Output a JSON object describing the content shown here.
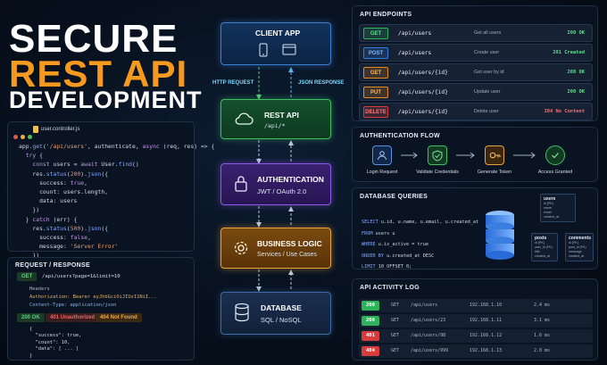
{
  "title": {
    "line1": "SECURE",
    "line2": "REST API",
    "line3": "DEVELOPMENT"
  },
  "editor": {
    "filename": "user.controller.js",
    "lines": [
      "app.get('/api/users', authenticate, async (req, res) => {",
      "  try {",
      "    const users = await User.find()",
      "    res.status(200).json({",
      "      success: true,",
      "      count: users.length,",
      "      data: users",
      "    })",
      "  } catch (err) {",
      "    res.status(500).json({",
      "      success: false,",
      "      message: 'Server Error'",
      "    })",
      "  }",
      "})"
    ]
  },
  "request_response": {
    "title": "REQUEST / RESPONSE",
    "method": "GET",
    "url": "/api/users?page=1&limit=10",
    "headers_label": "Headers",
    "auth_header": "Authorization: Bearer eyJhbGciOiJIUzI1NiI...",
    "content_type": "Content-Type: application/json",
    "status_ok": "200 OK",
    "status_401": "401 Unauthorized",
    "status_404": "404 Not Found",
    "body_lines": [
      "{",
      "  \"success\": true,",
      "  \"count\": 10,",
      "  \"data\": [ ... ]",
      "}"
    ]
  },
  "diagram": {
    "client": {
      "title": "CLIENT APP"
    },
    "http_request": "HTTP REQUEST",
    "json_response": "JSON RESPONSE",
    "rest": {
      "title": "REST API",
      "sub": "/api/*"
    },
    "auth": {
      "title": "AUTHENTICATION",
      "sub": "JWT / OAuth 2.0"
    },
    "logic": {
      "title": "BUSINESS LOGIC",
      "sub": "Services / Use Cases"
    },
    "db": {
      "title": "DATABASE",
      "sub": "SQL / NoSQL"
    }
  },
  "endpoints": {
    "title": "API ENDPOINTS",
    "rows": [
      {
        "method": "GET",
        "path": "/api/users",
        "desc": "Get all users",
        "status": "200 OK",
        "color": "#2fb35a"
      },
      {
        "method": "POST",
        "path": "/api/users",
        "desc": "Create user",
        "status": "201 Created",
        "color": "#2f7ee8"
      },
      {
        "method": "GET",
        "path": "/api/users/{id}",
        "desc": "Get user by id",
        "status": "200 OK",
        "color": "#e8891f"
      },
      {
        "method": "PUT",
        "path": "/api/users/{id}",
        "desc": "Update user",
        "status": "200 OK",
        "color": "#e8891f"
      },
      {
        "method": "DELETE",
        "path": "/api/users/{id}",
        "desc": "Delete user",
        "status": "204 No Content",
        "color": "#d83b3b"
      }
    ]
  },
  "auth_flow": {
    "title": "AUTHENTICATION FLOW",
    "steps": [
      "Login Request",
      "Validate Credentials",
      "Generate Token",
      "Access Granted"
    ]
  },
  "db_queries": {
    "title": "DATABASE QUERIES",
    "sql": [
      "SELECT u.id, u.name, u.email, u.created_at",
      "FROM users u",
      "WHERE u.is_active = true",
      "ORDER BY u.created_at DESC",
      "LIMIT 10 OFFSET 0;"
    ],
    "tables": [
      {
        "name": "users",
        "fields": [
          "id (PK)",
          "name",
          "email",
          "created_at"
        ]
      },
      {
        "name": "posts",
        "fields": [
          "id (PK)",
          "user_id (FK)",
          "title",
          "created_at"
        ]
      },
      {
        "name": "comments",
        "fields": [
          "id (PK)",
          "post_id (FK)",
          "message",
          "created_at"
        ]
      }
    ]
  },
  "activity_log": {
    "title": "API ACTIVITY LOG",
    "rows": [
      {
        "code": "200",
        "method": "GET",
        "path": "/api/users",
        "ip": "192.168.1.10",
        "time": "2.4 ms",
        "color": "#2fb35a"
      },
      {
        "code": "200",
        "method": "GET",
        "path": "/api/users/23",
        "ip": "192.168.1.11",
        "time": "3.1 ms",
        "color": "#2fb35a"
      },
      {
        "code": "401",
        "method": "GET",
        "path": "/api/users/98",
        "ip": "192.168.1.12",
        "time": "1.6 ms",
        "color": "#d83b3b"
      },
      {
        "code": "404",
        "method": "GET",
        "path": "/api/users/999",
        "ip": "192.168.1.13",
        "time": "2.0 ms",
        "color": "#d83b3b"
      }
    ]
  }
}
